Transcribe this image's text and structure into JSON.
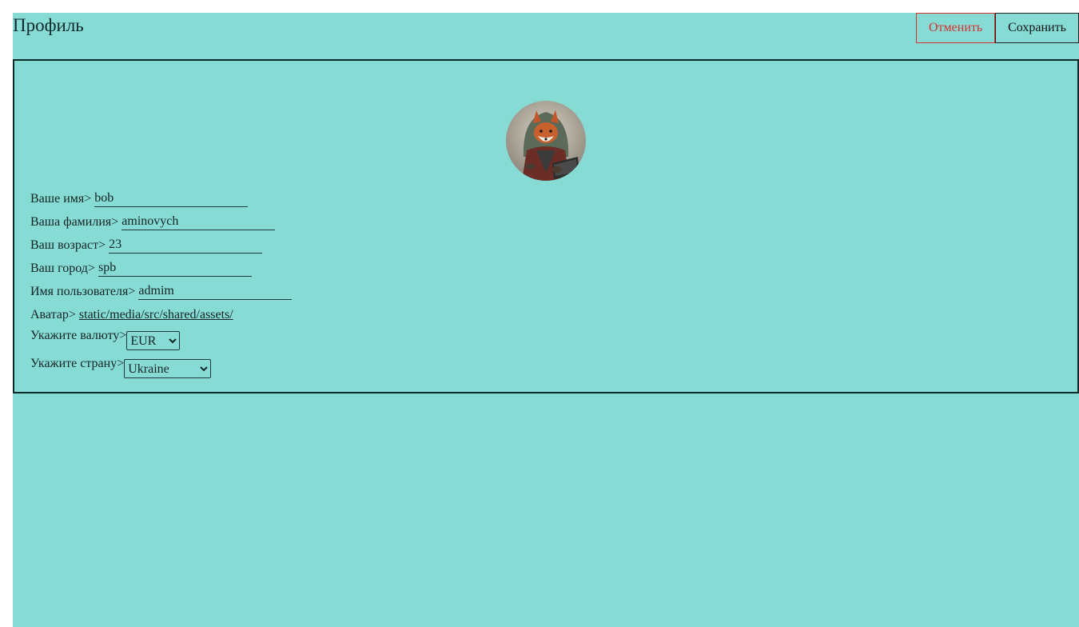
{
  "header": {
    "title": "Профиль",
    "cancel_label": "Отменить",
    "save_label": "Сохранить"
  },
  "profile": {
    "avatar_icon": "fox-hacker-avatar",
    "fields": [
      {
        "label": "Ваше имя>",
        "value": "bob"
      },
      {
        "label": "Ваша фамилия>",
        "value": "aminovych"
      },
      {
        "label": "Ваш возраст>",
        "value": "23"
      },
      {
        "label": "Ваш город>",
        "value": "spb"
      },
      {
        "label": "Имя пользователя>",
        "value": "admim"
      }
    ],
    "avatar_field": {
      "label": "Аватар>",
      "value": "static/media/src/shared/assets/"
    },
    "currency": {
      "label": "Укажите валюту>",
      "selected": "EUR"
    },
    "country": {
      "label": "Укажите страну>",
      "selected": "Ukraine"
    }
  },
  "colors": {
    "background": "#87dbd5",
    "cancel": "#d8322e"
  }
}
